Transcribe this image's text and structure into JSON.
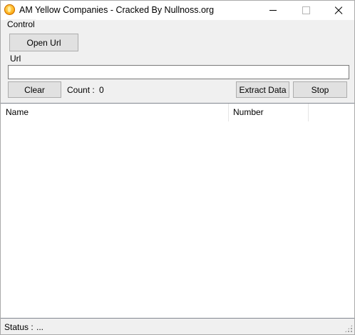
{
  "window": {
    "title": "AM Yellow Companies - Cracked By Nullnoss.org",
    "icon": "app-flame-icon"
  },
  "control_group": {
    "label": "Control",
    "open_url_label": "Open Url",
    "url_label": "Url",
    "url_value": "",
    "clear_label": "Clear",
    "count_label": "Count :",
    "count_value": "0",
    "extract_label": "Extract Data",
    "stop_label": "Stop"
  },
  "listview": {
    "columns": [
      "Name",
      "Number"
    ],
    "rows": []
  },
  "statusbar": {
    "label": "Status :",
    "value": "..."
  }
}
